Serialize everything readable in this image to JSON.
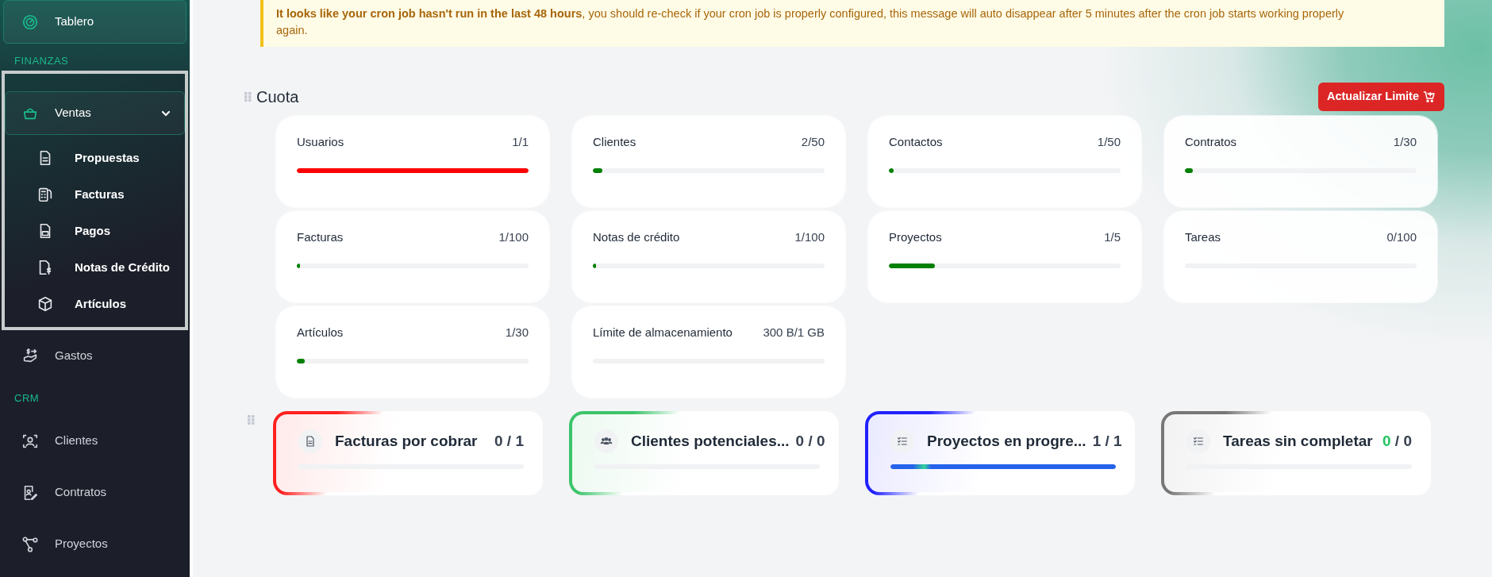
{
  "sidebar": {
    "items": [
      {
        "kind": "link",
        "label": "Tablero",
        "selected": true
      },
      {
        "kind": "heading",
        "label": "FINANZAS"
      },
      {
        "kind": "group",
        "label": "Ventas",
        "expanded": true,
        "children": [
          {
            "label": "Propuestas"
          },
          {
            "label": "Facturas"
          },
          {
            "label": "Pagos"
          },
          {
            "label": "Notas de Crédito"
          },
          {
            "label": "Artículos"
          }
        ]
      },
      {
        "kind": "link",
        "label": "Gastos",
        "selected": false
      },
      {
        "kind": "heading",
        "label": "CRM"
      },
      {
        "kind": "link",
        "label": "Clientes",
        "selected": false
      },
      {
        "kind": "link",
        "label": "Contratos",
        "selected": false
      },
      {
        "kind": "link",
        "label": "Proyectos",
        "selected": false
      }
    ]
  },
  "alert": {
    "strong": "It looks like your cron job hasn't run in the last 48 hours",
    "text": ", you should re-check if your cron job is properly configured, this message will auto disappear after 5 minutes after the cron job starts working properly again."
  },
  "quota": {
    "title": "Cuota",
    "button": "Actualizar Limite",
    "items": [
      {
        "label": "Usuarios",
        "value": "1/1",
        "level": 1.0,
        "color": "#ff0000"
      },
      {
        "label": "Clientes",
        "value": "2/50",
        "level": 0.04,
        "color": "#008000"
      },
      {
        "label": "Contactos",
        "value": "1/50",
        "level": 0.02,
        "color": "#008000"
      },
      {
        "label": "Contratos",
        "value": "1/30",
        "level": 0.033,
        "color": "#008000"
      },
      {
        "label": "Facturas",
        "value": "1/100",
        "level": 0.01,
        "color": "#008000"
      },
      {
        "label": "Notas de crédito",
        "value": "1/100",
        "level": 0.01,
        "color": "#008000"
      },
      {
        "label": "Proyectos",
        "value": "1/5",
        "level": 0.2,
        "color": "#008000"
      },
      {
        "label": "Tareas",
        "value": "0/100",
        "level": 0
      },
      {
        "label": "Artículos",
        "value": "1/30",
        "level": 0.033,
        "color": "#008000"
      },
      {
        "label": "Límite de almacenamiento",
        "value": "300 B/1 GB",
        "level": 0
      }
    ]
  },
  "stats": [
    {
      "title": "Facturas por cobrar",
      "count": "0",
      "total": " / 1",
      "highlight": false,
      "color": "#ff2020",
      "level": 0
    },
    {
      "title": "Clientes potenciales...",
      "count": "0",
      "total": " / 0",
      "highlight": false,
      "color": "#3cc46a",
      "level": 0
    },
    {
      "title": "Proyectos en progre...",
      "count": "1",
      "total": " / 1",
      "highlight": false,
      "color": "#2020ff",
      "level": 1.0
    },
    {
      "title": "Tareas sin completar",
      "count": "0",
      "total": " / 0",
      "highlight": true,
      "color": "#777777",
      "level": 0
    }
  ]
}
